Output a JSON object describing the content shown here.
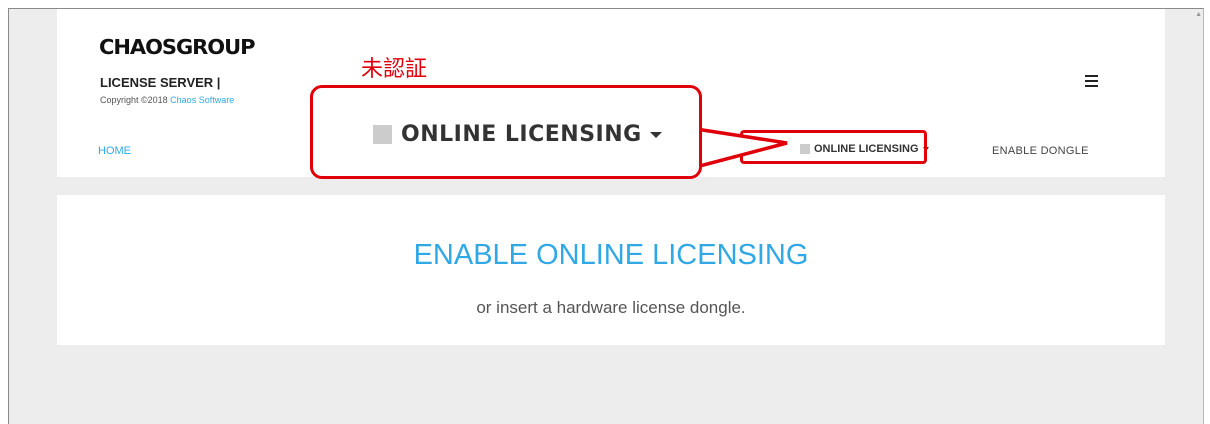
{
  "brand": {
    "logo_text": "CHAOSGROUP",
    "server_title": "LICENSE SERVER |",
    "copyright_prefix": "Copyright ©2018 ",
    "copyright_link": "Chaos Software"
  },
  "nav": {
    "home": "HOME",
    "online_licensing": "ONLINE LICENSING",
    "enable_dongle": "ENABLE DONGLE"
  },
  "annotation": {
    "label": "未認証",
    "zoom_text": "ONLINE LICENSING",
    "color": "#e0000a"
  },
  "main": {
    "title": "ENABLE ONLINE LICENSING",
    "subtitle": "or insert a hardware license dongle."
  },
  "icons": {
    "menu": "hamburger-menu-icon",
    "status": "status-square-icon",
    "dropdown": "caret-down-icon"
  },
  "colors": {
    "accent": "#31a8e6",
    "annotation": "#e0000a"
  }
}
